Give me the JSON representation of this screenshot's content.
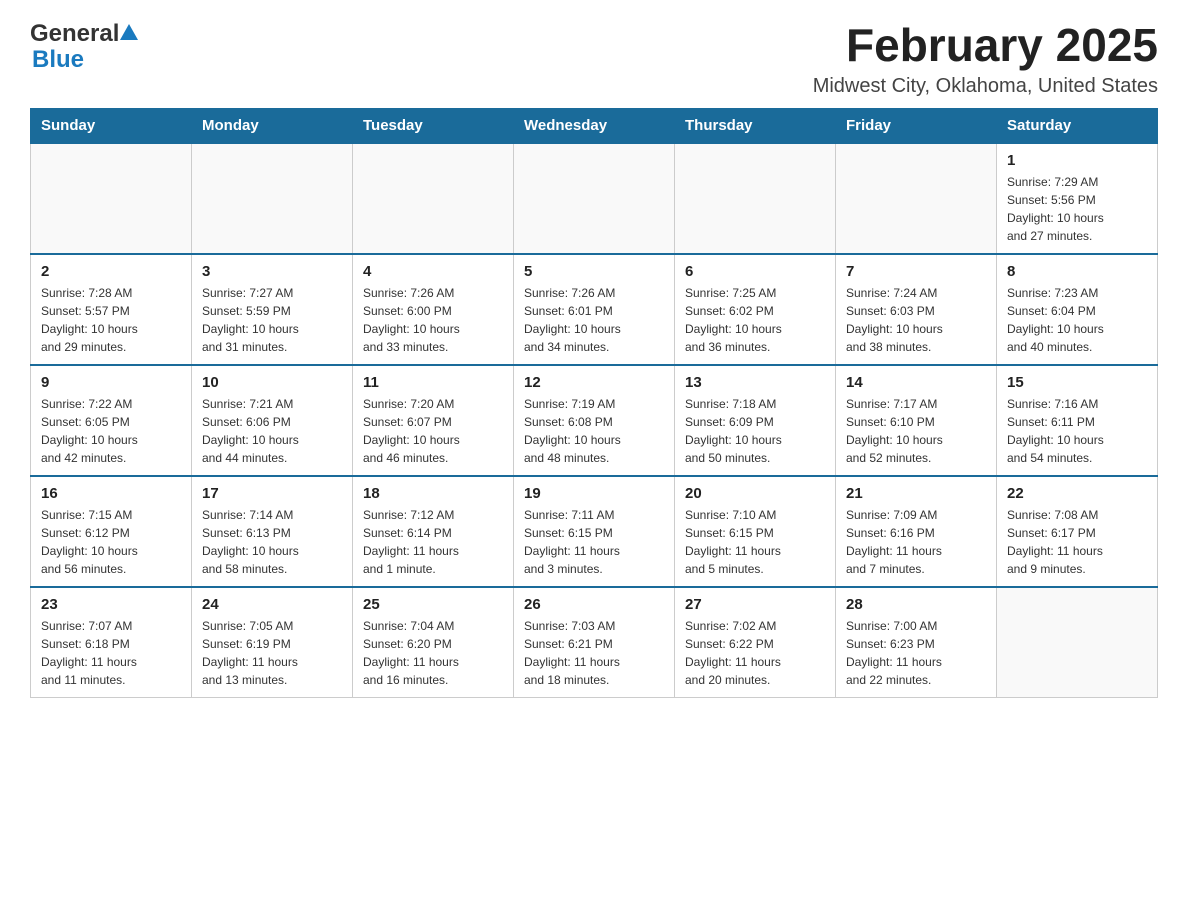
{
  "header": {
    "logo_general": "General",
    "logo_blue": "Blue",
    "title": "February 2025",
    "subtitle": "Midwest City, Oklahoma, United States"
  },
  "days_of_week": [
    "Sunday",
    "Monday",
    "Tuesday",
    "Wednesday",
    "Thursday",
    "Friday",
    "Saturday"
  ],
  "weeks": [
    [
      {
        "day": "",
        "info": ""
      },
      {
        "day": "",
        "info": ""
      },
      {
        "day": "",
        "info": ""
      },
      {
        "day": "",
        "info": ""
      },
      {
        "day": "",
        "info": ""
      },
      {
        "day": "",
        "info": ""
      },
      {
        "day": "1",
        "info": "Sunrise: 7:29 AM\nSunset: 5:56 PM\nDaylight: 10 hours\nand 27 minutes."
      }
    ],
    [
      {
        "day": "2",
        "info": "Sunrise: 7:28 AM\nSunset: 5:57 PM\nDaylight: 10 hours\nand 29 minutes."
      },
      {
        "day": "3",
        "info": "Sunrise: 7:27 AM\nSunset: 5:59 PM\nDaylight: 10 hours\nand 31 minutes."
      },
      {
        "day": "4",
        "info": "Sunrise: 7:26 AM\nSunset: 6:00 PM\nDaylight: 10 hours\nand 33 minutes."
      },
      {
        "day": "5",
        "info": "Sunrise: 7:26 AM\nSunset: 6:01 PM\nDaylight: 10 hours\nand 34 minutes."
      },
      {
        "day": "6",
        "info": "Sunrise: 7:25 AM\nSunset: 6:02 PM\nDaylight: 10 hours\nand 36 minutes."
      },
      {
        "day": "7",
        "info": "Sunrise: 7:24 AM\nSunset: 6:03 PM\nDaylight: 10 hours\nand 38 minutes."
      },
      {
        "day": "8",
        "info": "Sunrise: 7:23 AM\nSunset: 6:04 PM\nDaylight: 10 hours\nand 40 minutes."
      }
    ],
    [
      {
        "day": "9",
        "info": "Sunrise: 7:22 AM\nSunset: 6:05 PM\nDaylight: 10 hours\nand 42 minutes."
      },
      {
        "day": "10",
        "info": "Sunrise: 7:21 AM\nSunset: 6:06 PM\nDaylight: 10 hours\nand 44 minutes."
      },
      {
        "day": "11",
        "info": "Sunrise: 7:20 AM\nSunset: 6:07 PM\nDaylight: 10 hours\nand 46 minutes."
      },
      {
        "day": "12",
        "info": "Sunrise: 7:19 AM\nSunset: 6:08 PM\nDaylight: 10 hours\nand 48 minutes."
      },
      {
        "day": "13",
        "info": "Sunrise: 7:18 AM\nSunset: 6:09 PM\nDaylight: 10 hours\nand 50 minutes."
      },
      {
        "day": "14",
        "info": "Sunrise: 7:17 AM\nSunset: 6:10 PM\nDaylight: 10 hours\nand 52 minutes."
      },
      {
        "day": "15",
        "info": "Sunrise: 7:16 AM\nSunset: 6:11 PM\nDaylight: 10 hours\nand 54 minutes."
      }
    ],
    [
      {
        "day": "16",
        "info": "Sunrise: 7:15 AM\nSunset: 6:12 PM\nDaylight: 10 hours\nand 56 minutes."
      },
      {
        "day": "17",
        "info": "Sunrise: 7:14 AM\nSunset: 6:13 PM\nDaylight: 10 hours\nand 58 minutes."
      },
      {
        "day": "18",
        "info": "Sunrise: 7:12 AM\nSunset: 6:14 PM\nDaylight: 11 hours\nand 1 minute."
      },
      {
        "day": "19",
        "info": "Sunrise: 7:11 AM\nSunset: 6:15 PM\nDaylight: 11 hours\nand 3 minutes."
      },
      {
        "day": "20",
        "info": "Sunrise: 7:10 AM\nSunset: 6:15 PM\nDaylight: 11 hours\nand 5 minutes."
      },
      {
        "day": "21",
        "info": "Sunrise: 7:09 AM\nSunset: 6:16 PM\nDaylight: 11 hours\nand 7 minutes."
      },
      {
        "day": "22",
        "info": "Sunrise: 7:08 AM\nSunset: 6:17 PM\nDaylight: 11 hours\nand 9 minutes."
      }
    ],
    [
      {
        "day": "23",
        "info": "Sunrise: 7:07 AM\nSunset: 6:18 PM\nDaylight: 11 hours\nand 11 minutes."
      },
      {
        "day": "24",
        "info": "Sunrise: 7:05 AM\nSunset: 6:19 PM\nDaylight: 11 hours\nand 13 minutes."
      },
      {
        "day": "25",
        "info": "Sunrise: 7:04 AM\nSunset: 6:20 PM\nDaylight: 11 hours\nand 16 minutes."
      },
      {
        "day": "26",
        "info": "Sunrise: 7:03 AM\nSunset: 6:21 PM\nDaylight: 11 hours\nand 18 minutes."
      },
      {
        "day": "27",
        "info": "Sunrise: 7:02 AM\nSunset: 6:22 PM\nDaylight: 11 hours\nand 20 minutes."
      },
      {
        "day": "28",
        "info": "Sunrise: 7:00 AM\nSunset: 6:23 PM\nDaylight: 11 hours\nand 22 minutes."
      },
      {
        "day": "",
        "info": ""
      }
    ]
  ]
}
